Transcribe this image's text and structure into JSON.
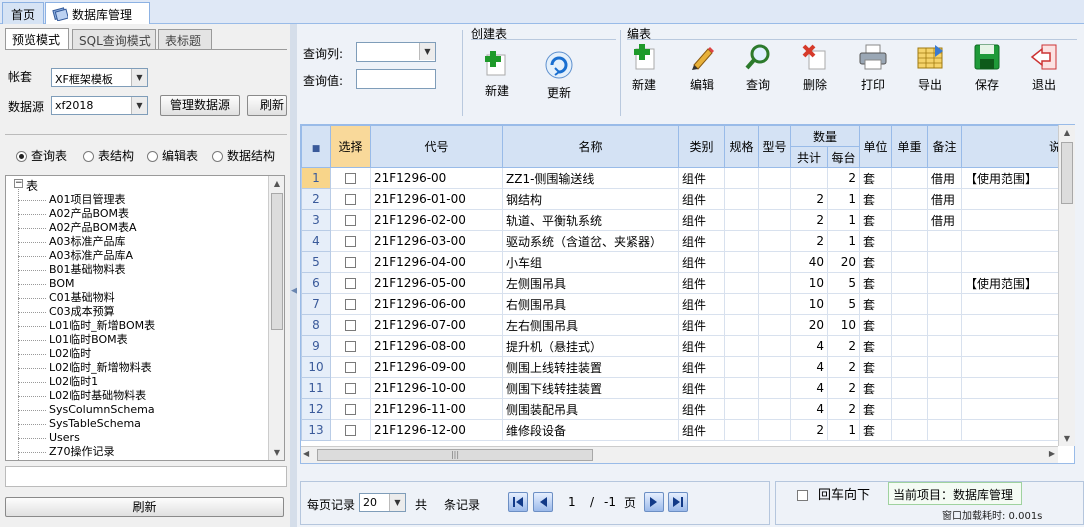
{
  "top_tabs": [
    {
      "label": "首页"
    },
    {
      "label": "数据库管理"
    }
  ],
  "left": {
    "tabs": [
      {
        "label": "预览模式"
      },
      {
        "label": "SQL查询模式"
      },
      {
        "label": "表标题"
      }
    ],
    "account_label": "帐套",
    "account_value": "XF框架模板",
    "datasource_label": "数据源",
    "datasource_value": "xf2018",
    "manage_ds_button": "管理数据源",
    "refresh_top_button": "刷新",
    "radios": [
      {
        "label": "查询表",
        "checked": true
      },
      {
        "label": "表结构",
        "checked": false
      },
      {
        "label": "编辑表",
        "checked": false
      },
      {
        "label": "数据结构",
        "checked": false
      }
    ],
    "tree_root": "表",
    "tree_nodes": [
      "A01项目管理表",
      "A02产品BOM表",
      "A02产品BOM表A",
      "A03标准产品库",
      "A03标准产品库A",
      "B01基础物料表",
      "BOM",
      "C01基础物料",
      "C03成本预算",
      "L01临时_新增BOM表",
      "L01临时BOM表",
      "L02临时",
      "L02临时_新增物料表",
      "L02临时1",
      "L02临时基础物料表",
      "SysColumnSchema",
      "SysTableSchema",
      "Users",
      "Z70操作记录"
    ],
    "refresh_button": "刷新"
  },
  "query": {
    "column_label": "查询列:",
    "value_label": "查询值:",
    "column_value": "",
    "value_value": ""
  },
  "toolbar": {
    "group_create": "创建表",
    "group_edit": "编表",
    "create_buttons": [
      {
        "label": "新建",
        "icon": "add-icon"
      },
      {
        "label": "更新",
        "icon": "refresh-icon"
      }
    ],
    "edit_buttons": [
      {
        "label": "新建",
        "icon": "add-icon"
      },
      {
        "label": "编辑",
        "icon": "edit-icon"
      },
      {
        "label": "查询",
        "icon": "search-icon"
      },
      {
        "label": "删除",
        "icon": "delete-icon"
      },
      {
        "label": "打印",
        "icon": "print-icon"
      },
      {
        "label": "导出",
        "icon": "export-icon"
      },
      {
        "label": "保存",
        "icon": "save-icon"
      },
      {
        "label": "退出",
        "icon": "exit-icon"
      }
    ]
  },
  "grid": {
    "headers": {
      "select": "选择",
      "code": "代号",
      "name": "名称",
      "category": "类别",
      "spec": "规格",
      "model": "型号",
      "qty": "数量",
      "total": "共计",
      "each": "每台",
      "unit": "单位",
      "price": "单重",
      "remark": "备注",
      "desc": "说"
    },
    "rows": [
      {
        "n": "1",
        "code": "21F1296-00",
        "name": "ZZ1-侧围输送线",
        "cat": "组件",
        "total": "",
        "each": "2",
        "unit": "套",
        "remark": "借用",
        "desc": "【使用范围】"
      },
      {
        "n": "2",
        "code": "21F1296-01-00",
        "name": "钢结构",
        "cat": "组件",
        "total": "2",
        "each": "1",
        "unit": "套",
        "remark": "借用",
        "desc": ""
      },
      {
        "n": "3",
        "code": "21F1296-02-00",
        "name": "轨道、平衡轨系统",
        "cat": "组件",
        "total": "2",
        "each": "1",
        "unit": "套",
        "remark": "借用",
        "desc": ""
      },
      {
        "n": "4",
        "code": "21F1296-03-00",
        "name": "驱动系统（含道岔、夹紧器）",
        "cat": "组件",
        "total": "2",
        "each": "1",
        "unit": "套",
        "remark": "",
        "desc": ""
      },
      {
        "n": "5",
        "code": "21F1296-04-00",
        "name": "小车组",
        "cat": "组件",
        "total": "40",
        "each": "20",
        "unit": "套",
        "remark": "",
        "desc": ""
      },
      {
        "n": "6",
        "code": "21F1296-05-00",
        "name": "左侧围吊具",
        "cat": "组件",
        "total": "10",
        "each": "5",
        "unit": "套",
        "remark": "",
        "desc": "【使用范围】"
      },
      {
        "n": "7",
        "code": "21F1296-06-00",
        "name": "右侧围吊具",
        "cat": "组件",
        "total": "10",
        "each": "5",
        "unit": "套",
        "remark": "",
        "desc": ""
      },
      {
        "n": "8",
        "code": "21F1296-07-00",
        "name": "左右侧围吊具",
        "cat": "组件",
        "total": "20",
        "each": "10",
        "unit": "套",
        "remark": "",
        "desc": ""
      },
      {
        "n": "9",
        "code": "21F1296-08-00",
        "name": "提升机（悬挂式）",
        "cat": "组件",
        "total": "4",
        "each": "2",
        "unit": "套",
        "remark": "",
        "desc": ""
      },
      {
        "n": "10",
        "code": "21F1296-09-00",
        "name": "侧围上线转挂装置",
        "cat": "组件",
        "total": "4",
        "each": "2",
        "unit": "套",
        "remark": "",
        "desc": ""
      },
      {
        "n": "11",
        "code": "21F1296-10-00",
        "name": "侧围下线转挂装置",
        "cat": "组件",
        "total": "4",
        "each": "2",
        "unit": "套",
        "remark": "",
        "desc": ""
      },
      {
        "n": "12",
        "code": "21F1296-11-00",
        "name": "侧围装配吊具",
        "cat": "组件",
        "total": "4",
        "each": "2",
        "unit": "套",
        "remark": "",
        "desc": ""
      },
      {
        "n": "13",
        "code": "21F1296-12-00",
        "name": "维修段设备",
        "cat": "组件",
        "total": "2",
        "each": "1",
        "unit": "套",
        "remark": "",
        "desc": ""
      }
    ]
  },
  "pager": {
    "per_page_label": "每页记录",
    "per_page_value": "20",
    "total_label": "共",
    "total_suffix": "条记录",
    "page_current": "1",
    "page_sep": "/",
    "page_total": "-1",
    "page_suffix": "页"
  },
  "status": {
    "enter_down_label": "回车向下",
    "current_item": "当前项目：数据库管理",
    "load_time": "窗口加载耗时: 0.001s"
  }
}
